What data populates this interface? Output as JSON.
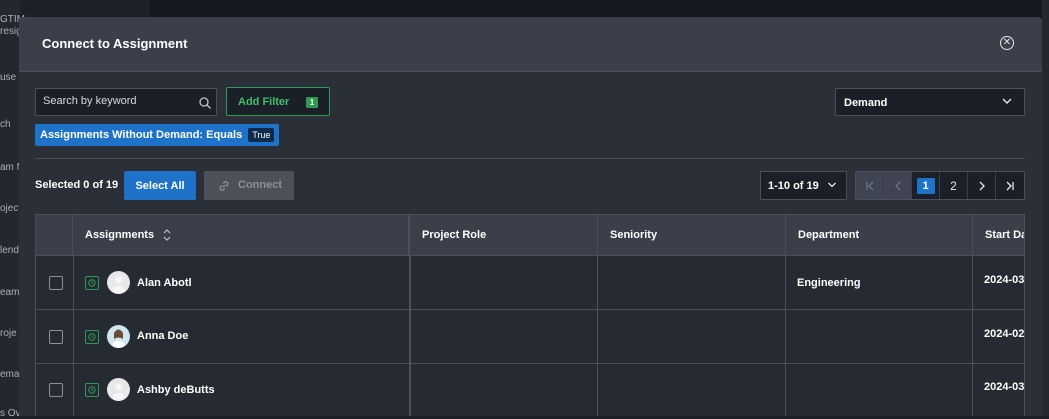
{
  "background": {
    "left_fragments": [
      "GTIM",
      "resig",
      "use I",
      "ch",
      "am M",
      "oject",
      "lend",
      "eam",
      "roje",
      "ema",
      "s Ov"
    ]
  },
  "modal": {
    "title": "Connect to Assignment",
    "search": {
      "placeholder": "Search by keyword",
      "value": ""
    },
    "add_filter": {
      "label": "Add Filter",
      "count": "1"
    },
    "type_select": {
      "value": "Demand"
    },
    "active_filter": {
      "label": "Assignments Without Demand:  Equals",
      "value": "True"
    },
    "selection": {
      "text": "Selected 0 of 19"
    },
    "select_all_label": "Select All",
    "connect_label": "Connect",
    "pagination": {
      "range": "1-10 of 19",
      "pages": [
        "1",
        "2"
      ],
      "current": "1"
    },
    "table": {
      "columns": [
        "Assignments",
        "Project Role",
        "Seniority",
        "Department",
        "Start Da"
      ],
      "rows": [
        {
          "name": "Alan Abotl",
          "project_role": "",
          "seniority": "",
          "department": "Engineering",
          "start": "2024-03"
        },
        {
          "name": "Anna Doe",
          "project_role": "",
          "seniority": "",
          "department": "",
          "start": "2024-02"
        },
        {
          "name": "Ashby deButts",
          "project_role": "",
          "seniority": "",
          "department": "",
          "start": "2024-03"
        }
      ]
    }
  },
  "colors": {
    "accent": "#1e73c8",
    "success": "#2e9a54",
    "modal_bg": "#2b2f38",
    "header_bg": "#3a3f4a"
  }
}
